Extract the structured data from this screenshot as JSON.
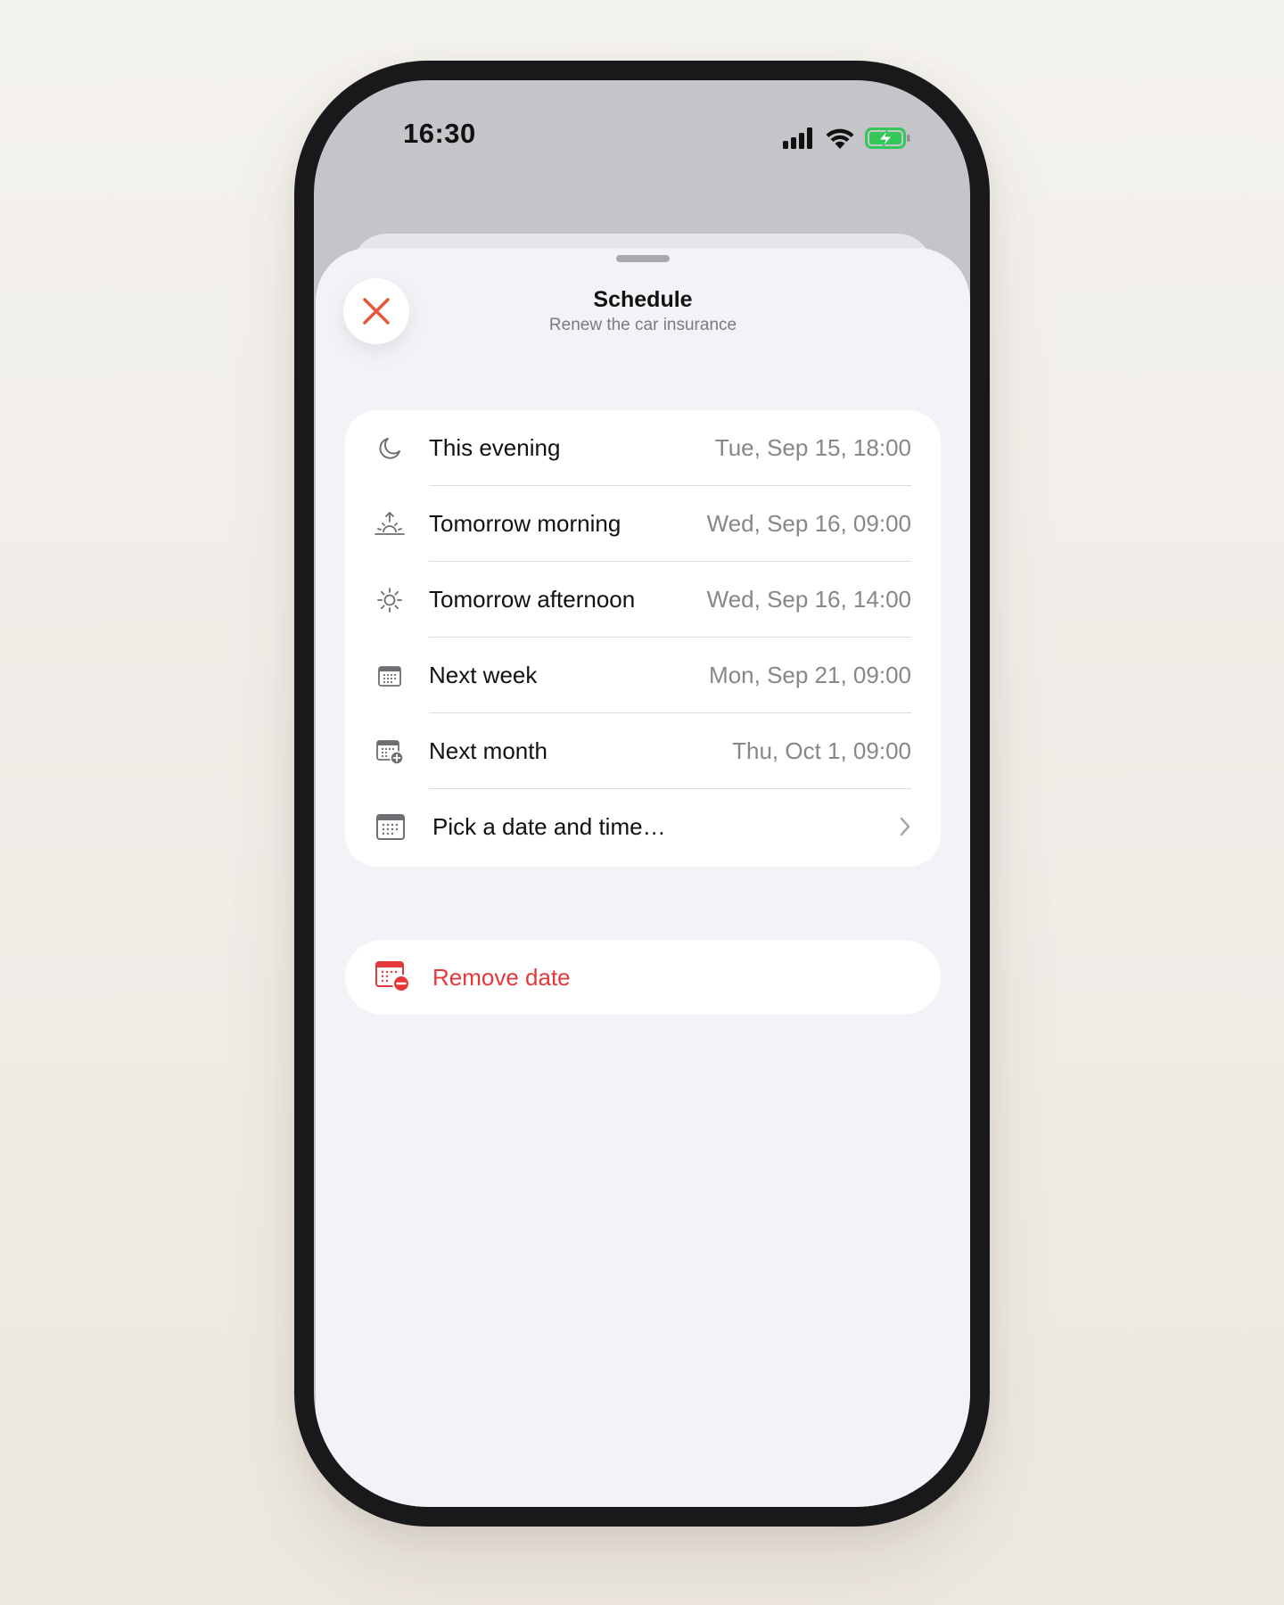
{
  "status_bar": {
    "time": "16:30",
    "icons": [
      "cellular-signal-icon",
      "wifi-icon",
      "battery-charging-icon"
    ],
    "battery_color": "#34c759"
  },
  "sheet": {
    "title": "Schedule",
    "subtitle": "Renew the car insurance",
    "close_icon": "close-icon",
    "accent_color": "#e5563b"
  },
  "options": [
    {
      "icon": "moon-icon",
      "label": "This evening",
      "value": "Tue, Sep 15, 18:00"
    },
    {
      "icon": "sunrise-icon",
      "label": "Tomorrow morning",
      "value": "Wed, Sep 16, 09:00"
    },
    {
      "icon": "sun-icon",
      "label": "Tomorrow afternoon",
      "value": "Wed, Sep 16, 14:00"
    },
    {
      "icon": "calendar-icon",
      "label": "Next week",
      "value": "Mon, Sep 21, 09:00"
    },
    {
      "icon": "calendar-plus-icon",
      "label": "Next month",
      "value": "Thu, Oct 1, 09:00"
    },
    {
      "icon": "calendar-icon",
      "label": "Pick a date and time…",
      "value": ""
    }
  ],
  "remove": {
    "icon": "calendar-remove-icon",
    "label": "Remove date",
    "color": "#e5383b"
  }
}
